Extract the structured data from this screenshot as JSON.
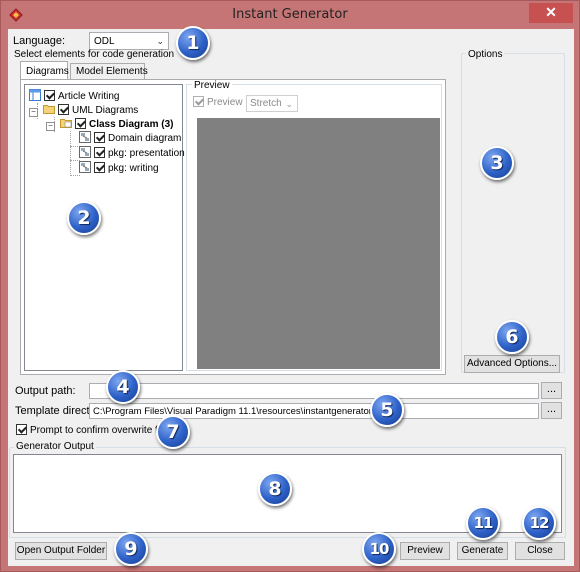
{
  "window": {
    "title": "Instant Generator",
    "close_glyph": "✕"
  },
  "language": {
    "label": "Language:",
    "value": "ODL"
  },
  "select_group": {
    "label": "Select elements for code generation"
  },
  "options_group": {
    "label": "Options"
  },
  "tabs": [
    {
      "label": "Diagrams",
      "active": true
    },
    {
      "label": "Model Elements",
      "active": false
    }
  ],
  "tree": {
    "root": {
      "label": "Article Writing",
      "icon": "project-icon",
      "checked": true
    },
    "uml": {
      "label": "UML Diagrams",
      "icon": "folder-icon",
      "checked": true
    },
    "class_diagram": {
      "label": "Class Diagram (3)",
      "icon": "folder-icon",
      "checked": true
    },
    "leaves": [
      {
        "label": "Domain diagram",
        "icon": "class-diagram-icon",
        "checked": true
      },
      {
        "label": "pkg: presentation",
        "icon": "class-diagram-icon",
        "checked": true
      },
      {
        "label": "pkg: writing",
        "icon": "class-diagram-icon",
        "checked": true
      }
    ]
  },
  "preview_panel": {
    "label": "Preview",
    "checkbox_label": "Preview",
    "checkbox_checked": true,
    "scale_value": "Stretch"
  },
  "advanced_options_label": "Advanced Options...",
  "output_path": {
    "label": "Output path:",
    "value": "",
    "browse_label": "..."
  },
  "template_directory": {
    "label": "Template directory:",
    "value": "C:\\Program Files\\Visual Paradigm 11.1\\resources\\instantgenerator\\odl",
    "browse_label": "..."
  },
  "prompt_overwrite": {
    "label": "Prompt to confirm overwrite file",
    "checked": true
  },
  "generator_output": {
    "label": "Generator Output",
    "text": ""
  },
  "buttons": {
    "open_output_folder": "Open Output Folder",
    "preview": "Preview",
    "generate": "Generate",
    "close": "Close"
  },
  "callouts": [
    "1",
    "2",
    "3",
    "4",
    "5",
    "6",
    "7",
    "8",
    "9",
    "10",
    "11",
    "12"
  ],
  "colors": {
    "title_bar": "#c57575",
    "close_button": "#c75050",
    "callout_blue": "#2d61c8",
    "preview_canvas": "#808080"
  }
}
